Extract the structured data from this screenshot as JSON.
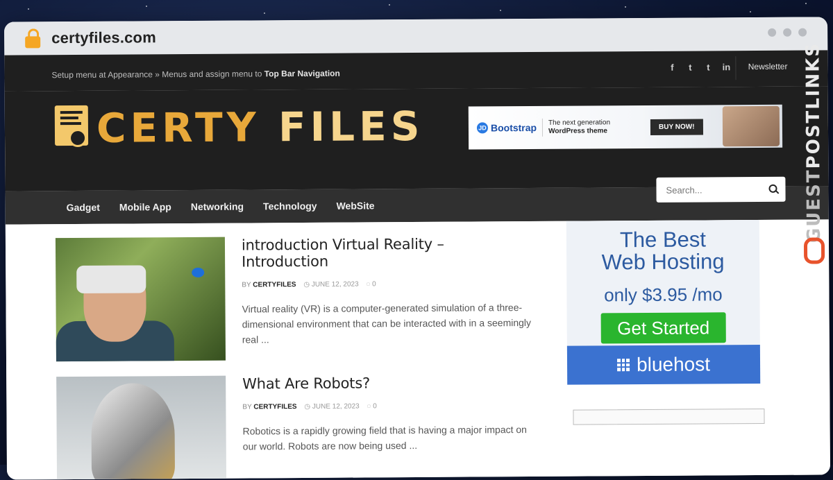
{
  "browser": {
    "url": "certyfiles.com"
  },
  "topbar": {
    "menu_note": "Setup menu at Appearance » Menus and assign menu to ",
    "menu_note_bold": "Top Bar Navigation",
    "social": [
      "f",
      "t",
      "t",
      "in"
    ],
    "newsletter": "Newsletter"
  },
  "logo": {
    "part1": "CERTY",
    "part2": "FILES"
  },
  "banner": {
    "brand": "Bootstrap",
    "tagline_line1": "The next generation",
    "tagline_line2": "WordPress theme",
    "cta": "BUY NOW!"
  },
  "nav": {
    "items": [
      "Gadget",
      "Mobile App",
      "Networking",
      "Technology",
      "WebSite"
    ],
    "search_placeholder": "Search..."
  },
  "posts": [
    {
      "title": "introduction Virtual Reality – Introduction",
      "by": "BY",
      "author": "CERTYFILES",
      "date": "JUNE 12, 2023",
      "comments": "0",
      "excerpt": "Virtual reality (VR) is a computer-generated simulation of a three-dimensional environment that can be interacted with in a seemingly real ..."
    },
    {
      "title": "What Are Robots?",
      "by": "BY",
      "author": "CERTYFILES",
      "date": "JUNE 12, 2023",
      "comments": "0",
      "excerpt": "Robotics is a rapidly growing field that is having a major impact on our world. Robots are now being used ..."
    }
  ],
  "sidebar_ad": {
    "line1": "The Best",
    "line2": "Web Hosting",
    "price": "only  $3.95 /mo",
    "cta": "Get Started",
    "brand": "bluehost"
  },
  "watermark": {
    "part1": "GUEST",
    "part2": "POSTLINKS"
  },
  "colors": {
    "logo_orange": "#e8a83a",
    "logo_light": "#f6d58d",
    "header_bg": "#1f1f1f",
    "nav_bg": "#303030",
    "cta_green": "#2ab52e",
    "bluehost_blue": "#3b72d0"
  }
}
